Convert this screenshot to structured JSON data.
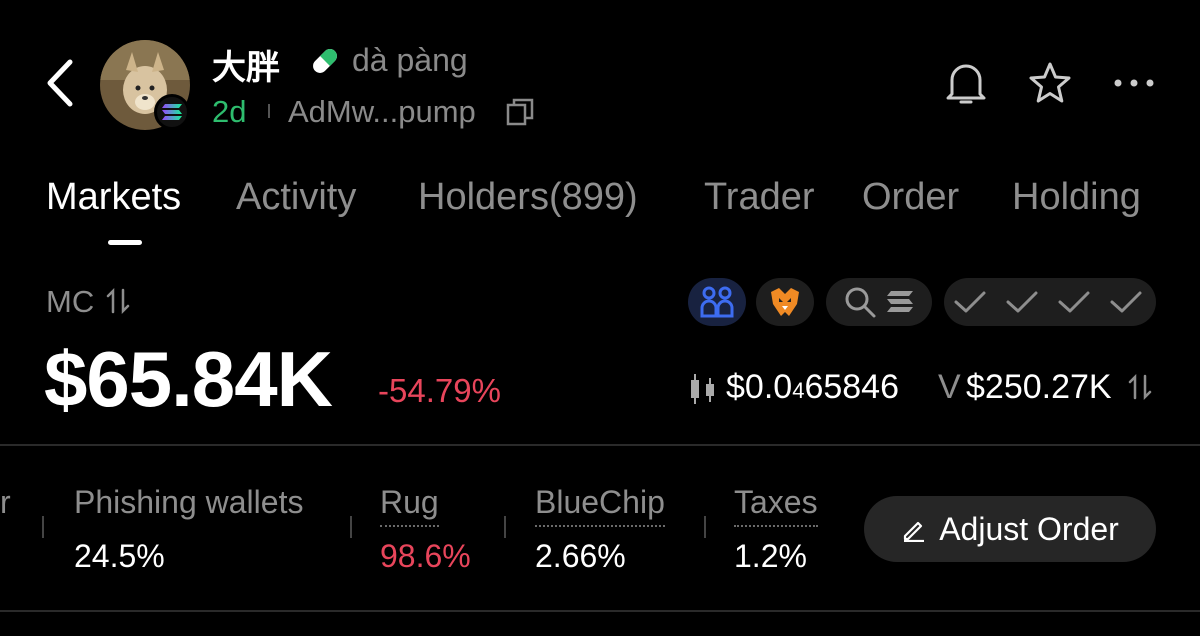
{
  "header": {
    "token_name": "大胖",
    "token_pinyin": "dà pàng",
    "age": "2d",
    "address": "AdMw...pump",
    "icons": [
      "back-icon",
      "pill-icon",
      "solana-icon",
      "copy-icon",
      "bell-icon",
      "star-icon",
      "more-icon"
    ]
  },
  "tabs": [
    {
      "label": "Markets",
      "active": true
    },
    {
      "label": "Activity"
    },
    {
      "label": "Holders(899)"
    },
    {
      "label": "Trader"
    },
    {
      "label": "Order"
    },
    {
      "label": "Holding"
    }
  ],
  "market": {
    "mc_label": "MC",
    "mc_value": "$65.84K",
    "mc_change": "-54.79%",
    "price_prefix": "$0.0",
    "price_zeros": "4",
    "price_digits": "65846",
    "volume_label": "V",
    "volume_value": "$250.27K"
  },
  "stats": [
    {
      "label": "r",
      "value": ""
    },
    {
      "label": "Phishing wallets",
      "value": "24.5%"
    },
    {
      "label": "Rug",
      "value": "98.6%"
    },
    {
      "label": "BlueChip",
      "value": "2.66%"
    },
    {
      "label": "Taxes",
      "value": "1.2%"
    }
  ],
  "actions": {
    "adjust_order": "Adjust Order"
  },
  "colors": {
    "background": "#000000",
    "positive": "#2ebd6e",
    "negative": "#e8455b",
    "muted": "#8e8e8e",
    "holders_badge": "#3d6cf0",
    "eagle_badge": "#f08a24"
  }
}
